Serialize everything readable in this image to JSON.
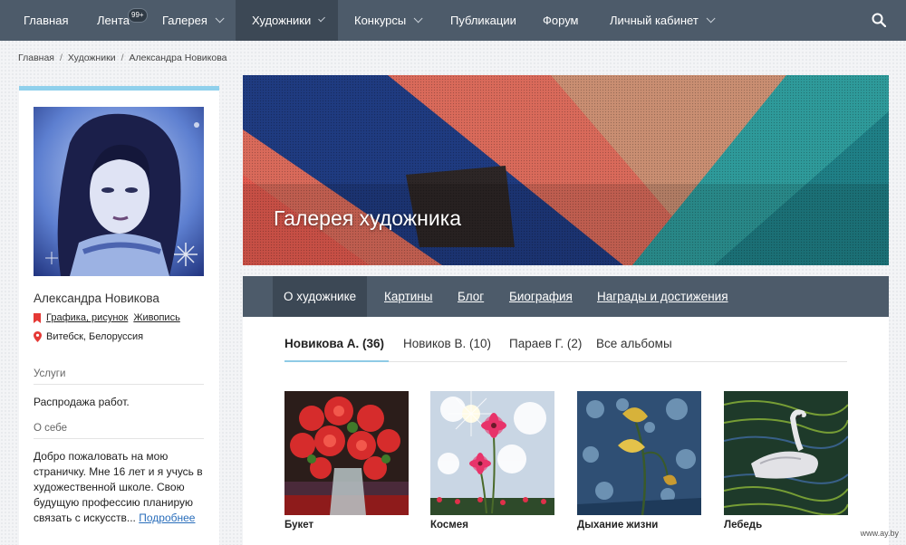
{
  "nav": {
    "items": [
      {
        "label": "Главная"
      },
      {
        "label": "Лента"
      },
      {
        "label": "Галерея"
      },
      {
        "label": "Художники"
      },
      {
        "label": "Конкурсы"
      },
      {
        "label": "Публикации"
      },
      {
        "label": "Форум"
      },
      {
        "label": "Личный кабинет"
      }
    ],
    "feed_badge": "99+",
    "active": "Художники",
    "search_icon": "search-icon"
  },
  "breadcrumb": {
    "items": [
      "Главная",
      "Художники",
      "Александра Новикова"
    ],
    "separator": "/"
  },
  "profile": {
    "name": "Александра Новикова",
    "tags": [
      "Графика, рисунок",
      "Живопись"
    ],
    "location": "Витебск, Белоруссия",
    "services_title": "Услуги",
    "services_text": "Распродажа работ.",
    "about_title": "О себе",
    "about_text": "Добро пожаловать на мою страничку. Мне 16 лет и я учусь в художественной школе. Свою будущую профессию планирую связать с искусств...",
    "more_link": "Подробнее"
  },
  "banner": {
    "title": "Галерея художника"
  },
  "tabs": [
    {
      "label": "О художнике"
    },
    {
      "label": "Картины"
    },
    {
      "label": "Блог"
    },
    {
      "label": "Биография"
    },
    {
      "label": "Награды и достижения"
    }
  ],
  "albums": [
    {
      "label": "Новикова А. (36)"
    },
    {
      "label": "Новиков В. (10)"
    },
    {
      "label": "Параев Г. (2)"
    },
    {
      "label": "Все альбомы"
    }
  ],
  "artworks": [
    {
      "title": "Букет"
    },
    {
      "title": "Космея"
    },
    {
      "title": "Дыхание жизни"
    },
    {
      "title": "Лебедь"
    }
  ],
  "watermark": "www.ay.by",
  "colors": {
    "nav_bg": "#4d5b6a",
    "nav_active": "#3c4855",
    "accent": "#8fd0ec",
    "link": "#2a6ebb",
    "pin": "#e53935"
  }
}
